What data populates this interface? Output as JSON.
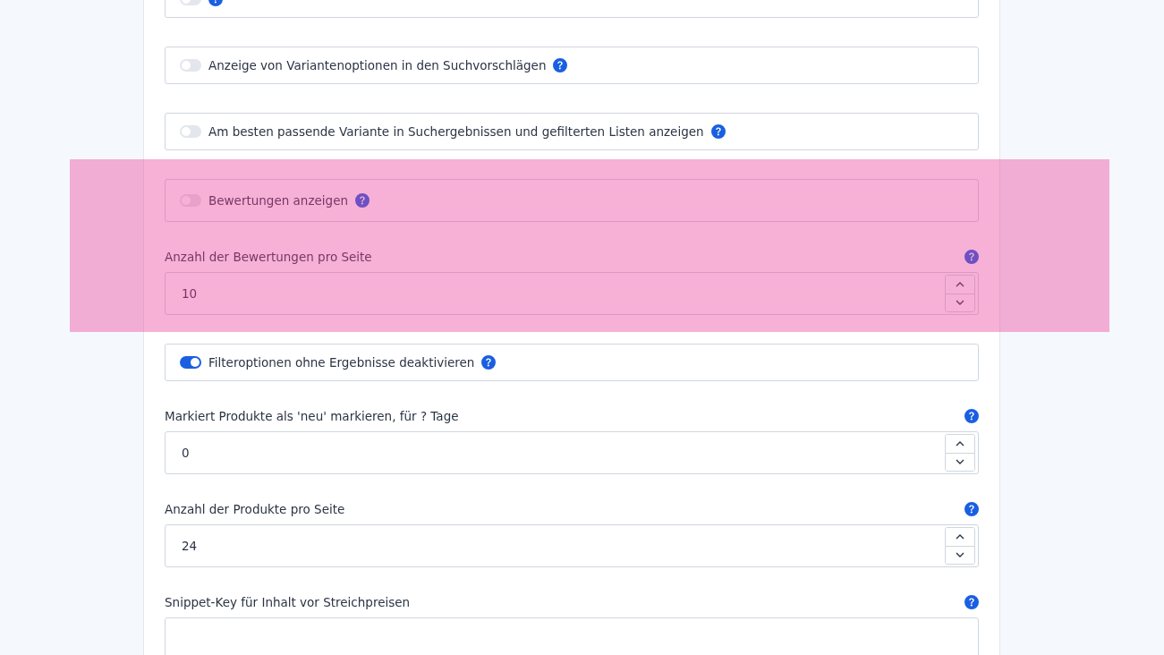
{
  "settings": [
    {
      "kind": "toggle",
      "on": false,
      "highlighted": false
    },
    {
      "kind": "toggle",
      "label": "Anzeige von Variantenoptionen in den Suchvorschlägen",
      "on": false,
      "highlighted": false
    },
    {
      "kind": "toggle",
      "label": "Am besten passende Variante in Suchergebnissen und gefilterten Listen anzeigen",
      "on": false,
      "highlighted": false
    },
    {
      "kind": "toggle",
      "label": "Bewertungen anzeigen",
      "on": false,
      "highlighted": true
    },
    {
      "kind": "number",
      "label": "Anzahl der Bewertungen pro Seite",
      "value": "10",
      "highlighted": true
    },
    {
      "kind": "toggle",
      "label": "Filteroptionen ohne Ergebnisse deaktivieren",
      "on": true,
      "highlighted": false
    },
    {
      "kind": "number",
      "label": "Markiert Produkte als 'neu' markieren, für ? Tage",
      "value": "0",
      "highlighted": false
    },
    {
      "kind": "number",
      "label": "Anzahl der Produkte pro Seite",
      "value": "24",
      "highlighted": false
    },
    {
      "kind": "text",
      "label": "Snippet-Key für Inhalt vor Streichpreisen",
      "highlighted": false
    }
  ]
}
